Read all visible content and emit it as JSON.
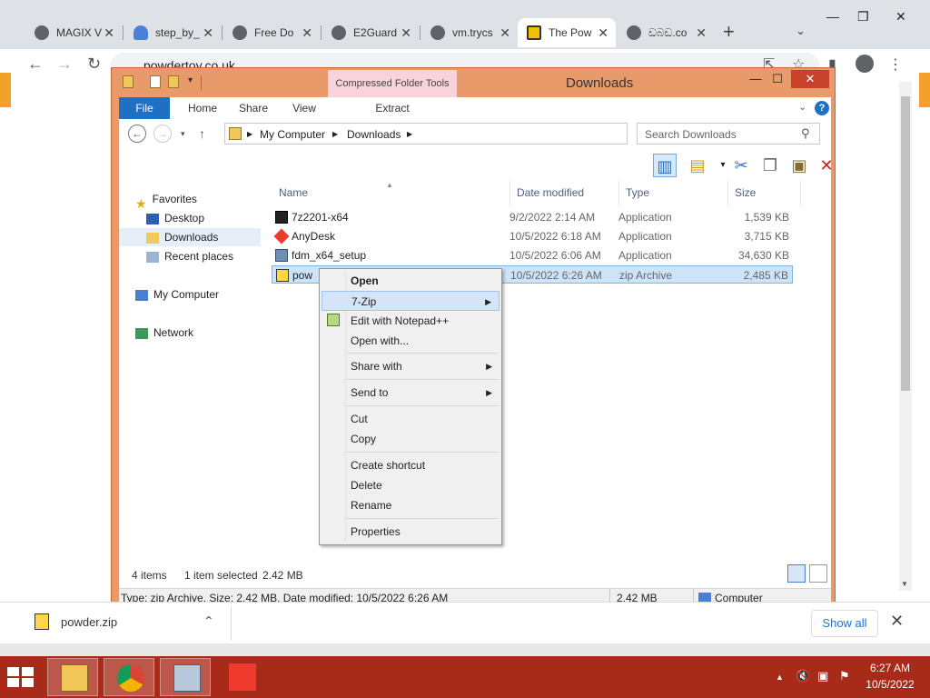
{
  "browser": {
    "tabs": [
      {
        "title": "MAGIX V",
        "icon": "globe-icon"
      },
      {
        "title": "step_by_",
        "icon": "cloud-icon"
      },
      {
        "title": "Free Do",
        "icon": "globe-icon"
      },
      {
        "title": "E2Guard",
        "icon": "globe-icon"
      },
      {
        "title": "vm.trycs",
        "icon": "globe-icon"
      },
      {
        "title": "The Pow",
        "icon": "film-icon",
        "active": true
      },
      {
        "title": "ඩබඩ.co",
        "icon": "globe-icon"
      }
    ],
    "url": "powdertoy.co.uk",
    "colors": {
      "tabbar": "#dee1e6",
      "accent": "#1a73e8",
      "page_accent": "#f3a12b"
    }
  },
  "downloads_bar": {
    "file": "powder.zip",
    "show_all": "Show all"
  },
  "explorer": {
    "title": "Downloads",
    "contextual_tab_group": "Compressed Folder Tools",
    "ribbon_tabs": [
      "File",
      "Home",
      "Share",
      "View"
    ],
    "contextual_tab": "Extract",
    "breadcrumb": [
      "My Computer",
      "Downloads"
    ],
    "search_placeholder": "Search Downloads",
    "nav": {
      "favorites": "Favorites",
      "desktop": "Desktop",
      "downloads": "Downloads",
      "recent": "Recent places",
      "computer": "My Computer",
      "network": "Network"
    },
    "columns": {
      "name": "Name",
      "date": "Date modified",
      "type": "Type",
      "size": "Size"
    },
    "files": [
      {
        "name": "7z2201-x64",
        "date": "9/2/2022 2:14 AM",
        "type": "Application",
        "size": "1,539 KB"
      },
      {
        "name": "AnyDesk",
        "date": "10/5/2022 6:18 AM",
        "type": "Application",
        "size": "3,715 KB"
      },
      {
        "name": "fdm_x64_setup",
        "date": "10/5/2022 6:06 AM",
        "type": "Application",
        "size": "34,630 KB"
      },
      {
        "name": "pow",
        "date": "10/5/2022 6:26 AM",
        "type": "zip Archive",
        "size": "2,485 KB"
      }
    ],
    "status": {
      "count": "4 items",
      "selected": "1 item selected",
      "selected_size": "2.42 MB"
    },
    "details_bar": {
      "text": "Type: zip Archive, Size: 2.42 MB, Date modified: 10/5/2022 6:26 AM",
      "size": "2.42 MB",
      "location": "Computer"
    },
    "colors": {
      "frame": "#e89a6b",
      "file_tab": "#1f6fc5",
      "contextual": "#f9d3db",
      "close": "#c7412b",
      "selection": "#cde3f8"
    }
  },
  "context_menu": {
    "open": "Open",
    "seven_zip": "7-Zip",
    "edit_notepad": "Edit with Notepad++",
    "open_with": "Open with...",
    "share_with": "Share with",
    "send_to": "Send to",
    "cut": "Cut",
    "copy": "Copy",
    "create_shortcut": "Create shortcut",
    "delete": "Delete",
    "rename": "Rename",
    "properties": "Properties"
  },
  "taskbar": {
    "apps": [
      "file-explorer-icon",
      "chrome-icon",
      "network-computer-icon",
      "anydesk-icon"
    ],
    "clock_time": "6:27 AM",
    "clock_date": "10/5/2022",
    "colors": {
      "bar": "#a82a19"
    }
  }
}
